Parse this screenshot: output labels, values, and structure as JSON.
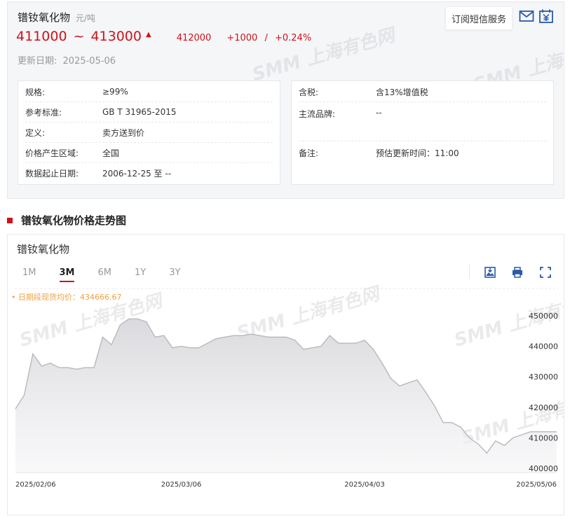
{
  "product": {
    "title": "镨钕氧化物",
    "unit": "元/吨",
    "price_low": "411000",
    "price_sep": "~",
    "price_high": "413000",
    "avg_price": "412000",
    "change": "+1000",
    "change_sep": "/",
    "change_pct": "+0.24%",
    "update_label": "更新日期:",
    "update_date": "2025-05-06"
  },
  "actions": {
    "sms_label": "订阅短信服务"
  },
  "watermark": "SMM 上海有色网",
  "specs_left": [
    {
      "key": "规格:",
      "value": "≥99%"
    },
    {
      "key": "参考标准:",
      "value": "GB T 31965-2015"
    },
    {
      "key": "定义:",
      "value": "卖方送到价"
    },
    {
      "key": "价格产生区域:",
      "value": "全国"
    },
    {
      "key": "数据起止日期:",
      "value": "2006-12-25 至 --"
    }
  ],
  "specs_right": [
    {
      "key": "含税:",
      "value": "含13%增值税"
    },
    {
      "key": "主流品牌:",
      "value": "--"
    },
    {
      "key": "备注:",
      "value": "预估更新时间：11:00"
    }
  ],
  "section": {
    "title": "镨钕氧化物价格走势图"
  },
  "chart_card": {
    "title": "镨钕氧化物",
    "tabs": [
      "1M",
      "3M",
      "6M",
      "1Y",
      "3Y"
    ],
    "active_tab": "3M",
    "avg_label": "• 日期段现货均价：434666.67"
  },
  "colors": {
    "accent": "#d0111b",
    "icon_blue": "#2a5aa8",
    "avg_orange": "#f0a040"
  },
  "chart_data": {
    "type": "area",
    "title": "",
    "xlabel": "",
    "ylabel": "",
    "ylim": [
      400000,
      450000
    ],
    "yticks": [
      400000,
      410000,
      420000,
      430000,
      440000,
      450000
    ],
    "ytick_labels": [
      "400000",
      "410000",
      "420000",
      "430000",
      "440000",
      "450000"
    ],
    "x_tick_labels": [
      "2025/02/06",
      "2025/03/06",
      "2025/04/03",
      "2025/05/06"
    ],
    "x_tick_index": [
      0,
      19,
      40,
      62
    ],
    "average": 434666.67,
    "legend": "none",
    "grid": false,
    "values": [
      419500,
      424000,
      437500,
      433500,
      434500,
      433000,
      433000,
      432500,
      433000,
      433000,
      443000,
      440500,
      447000,
      449000,
      449000,
      448000,
      443000,
      443500,
      439500,
      440000,
      439500,
      439500,
      441000,
      442500,
      443000,
      443500,
      443500,
      444000,
      443500,
      443000,
      443000,
      443000,
      442000,
      439000,
      439500,
      440000,
      443500,
      441000,
      441000,
      441000,
      442000,
      439000,
      434500,
      429500,
      427000,
      428000,
      429000,
      425000,
      420500,
      415000,
      415000,
      413500,
      410000,
      408000,
      405000,
      409000,
      407500,
      410000,
      411000,
      412000,
      412000,
      412000,
      412000
    ]
  }
}
